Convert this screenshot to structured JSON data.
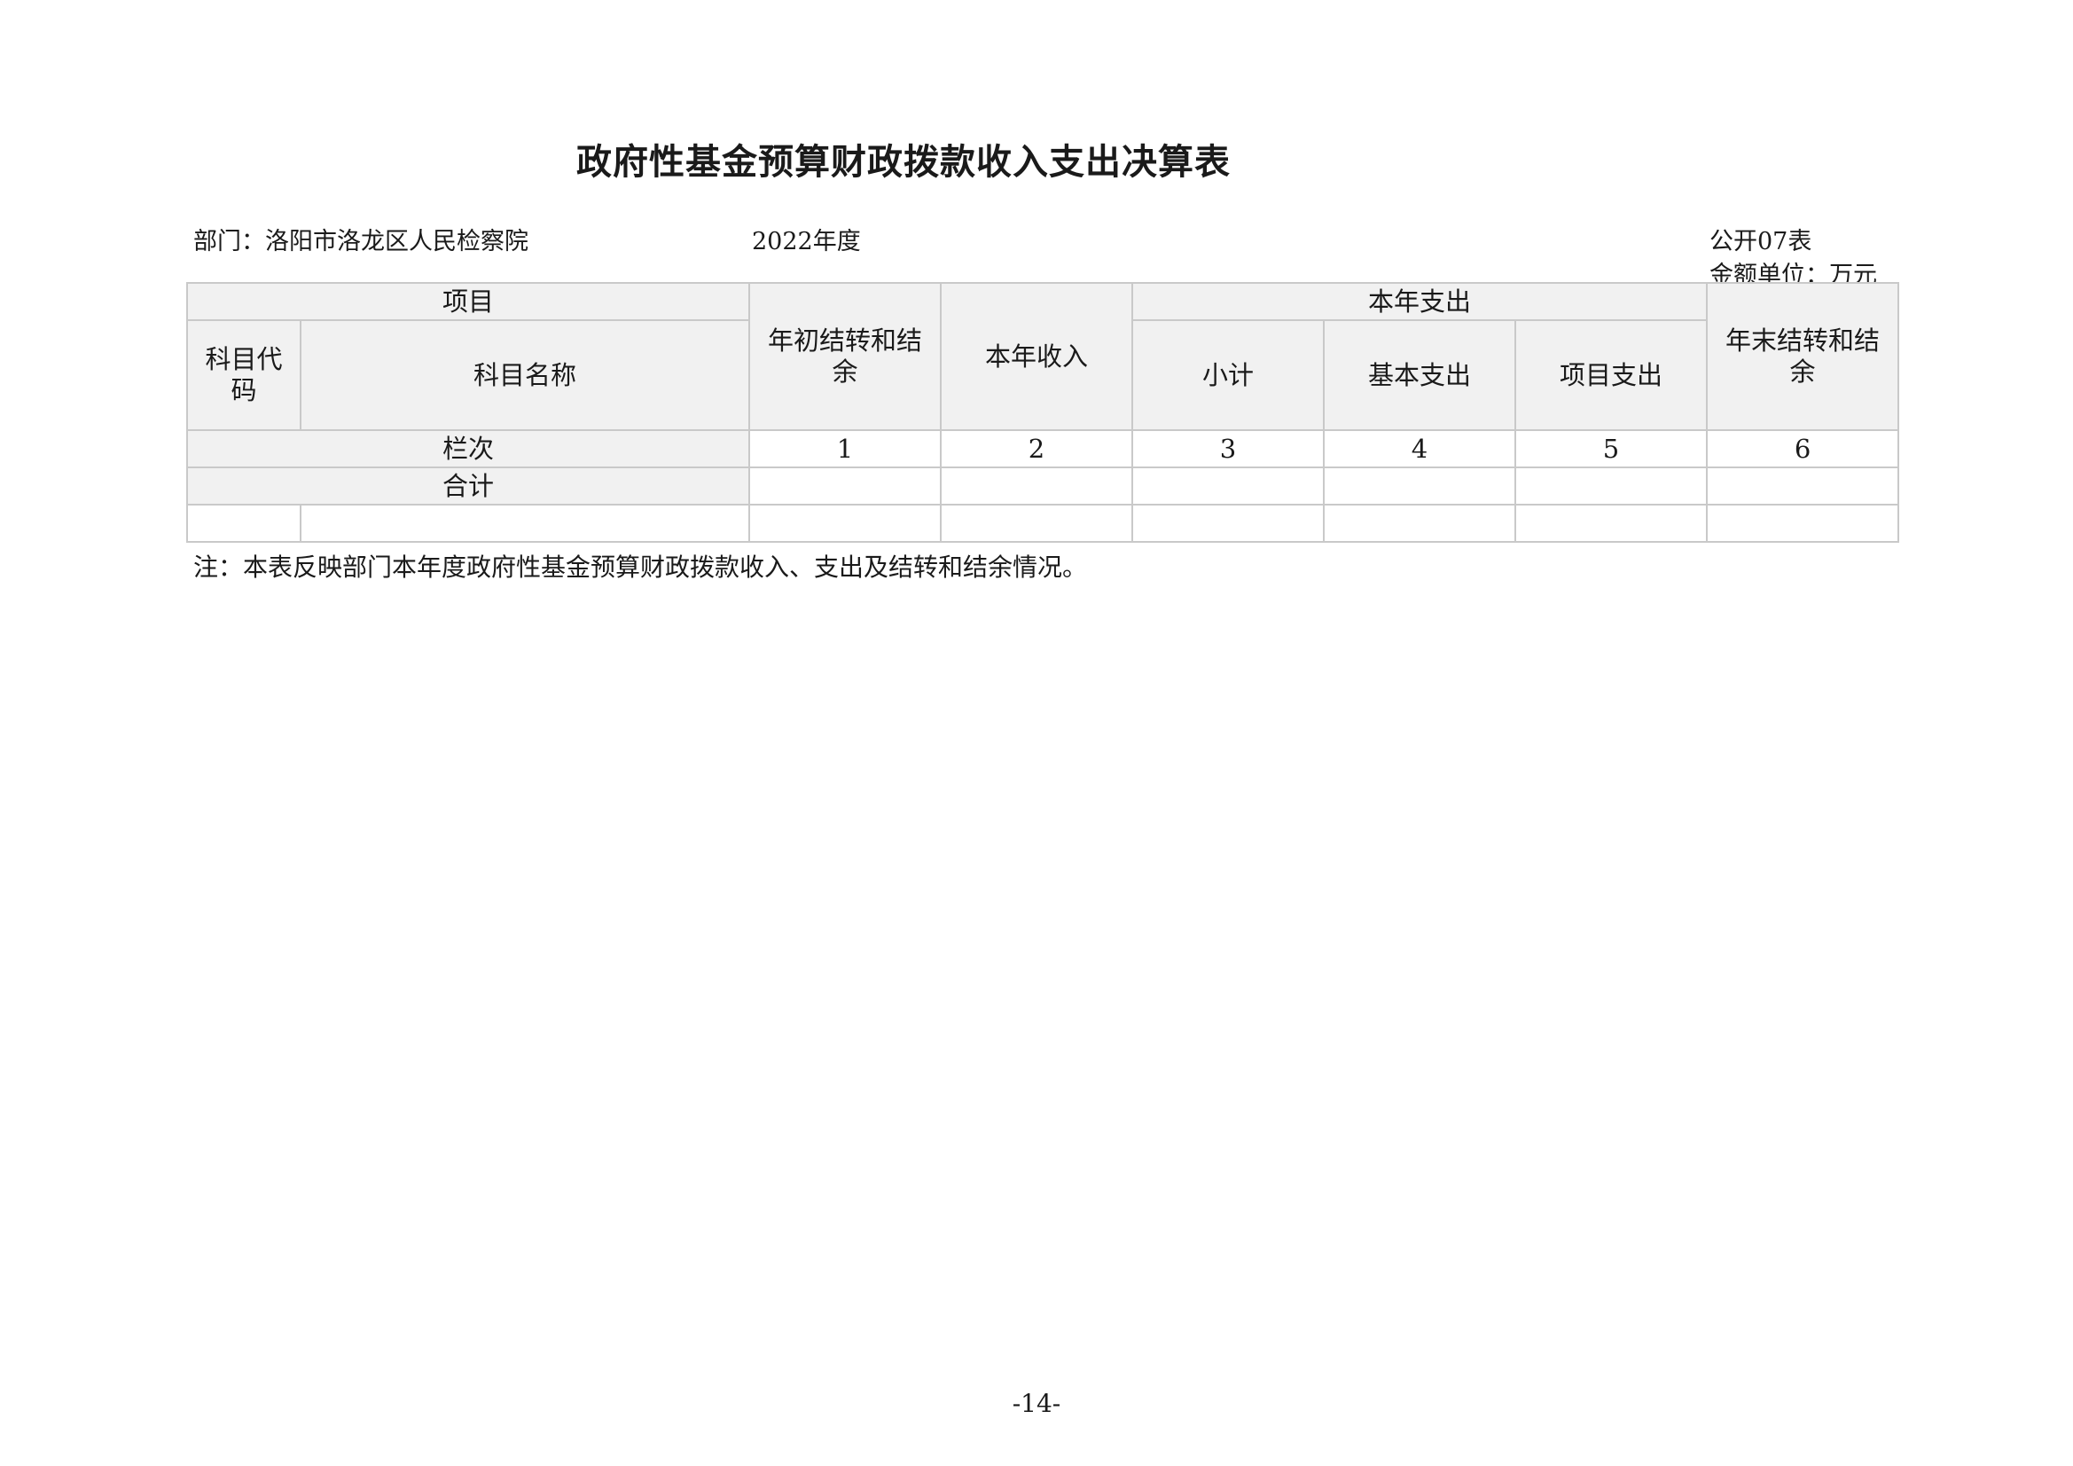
{
  "title": "政府性基金预算财政拨款收入支出决算表",
  "meta": {
    "department": "部门：洛阳市洛龙区人民检察院",
    "year": "2022年度",
    "table_code": "公开07表",
    "unit": "金额单位：万元"
  },
  "table": {
    "header": {
      "project": "项目",
      "subject_code": "科目代码",
      "subject_name": "科目名称",
      "opening_balance": "年初结转和结余",
      "current_income": "本年收入",
      "current_expense": "本年支出",
      "subtotal": "小计",
      "basic_expense": "基本支出",
      "project_expense": "项目支出",
      "closing_balance": "年末结转和结余"
    },
    "column_row": {
      "label": "栏次",
      "cols": [
        "1",
        "2",
        "3",
        "4",
        "5",
        "6"
      ]
    },
    "total_row": {
      "label": "合计",
      "values": [
        "",
        "",
        "",
        "",
        "",
        ""
      ]
    },
    "data_rows": [
      {
        "code": "",
        "name": "",
        "values": [
          "",
          "",
          "",
          "",
          "",
          ""
        ]
      }
    ]
  },
  "note": "注：本表反映部门本年度政府性基金预算财政拨款收入、支出及结转和结余情况。",
  "page_number": "-14-"
}
